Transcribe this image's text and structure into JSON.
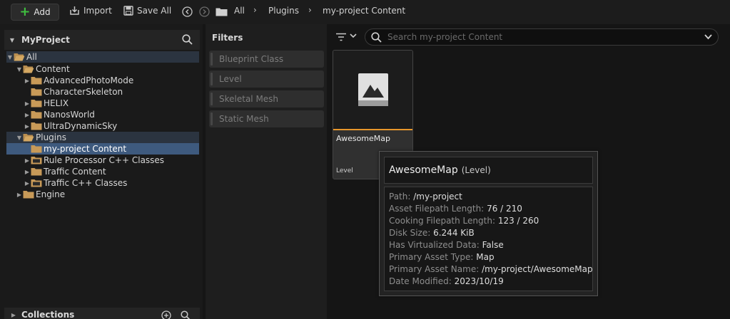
{
  "toolbar": {
    "add_label": "Add",
    "import_label": "Import",
    "save_all_label": "Save All"
  },
  "breadcrumb": [
    "All",
    "Plugins",
    "my-project Content"
  ],
  "sources": {
    "title": "MyProject",
    "tree": {
      "all": "All",
      "content": "Content",
      "advanced_photo_mode": "AdvancedPhotoMode",
      "character_skeleton": "CharacterSkeleton",
      "helix": "HELIX",
      "nanos_world": "NanosWorld",
      "ultra_dynamic_sky": "UltraDynamicSky",
      "plugins": "Plugins",
      "my_project_content": "my-project Content",
      "rule_processor": "Rule Processor C++ Classes",
      "traffic_content": "Traffic Content",
      "traffic_cpp": "Traffic C++ Classes",
      "engine": "Engine"
    },
    "collections_label": "Collections"
  },
  "filters": {
    "title": "Filters",
    "items": [
      "Blueprint Class",
      "Level",
      "Skeletal Mesh",
      "Static Mesh"
    ]
  },
  "search": {
    "placeholder": "Search my-project Content"
  },
  "asset": {
    "name": "AwesomeMap",
    "type": "Level"
  },
  "tooltip": {
    "name": "AwesomeMap",
    "type": "(Level)",
    "rows": [
      {
        "key": "Path:",
        "value": "/my-project"
      },
      {
        "key": "Asset Filepath Length:",
        "value": "76 / 210"
      },
      {
        "key": "Cooking Filepath Length:",
        "value": "123 / 260"
      },
      {
        "key": "Disk Size:",
        "value": "6.244 KiB"
      },
      {
        "key": "Has Virtualized Data:",
        "value": "False"
      },
      {
        "key": "Primary Asset Type:",
        "value": "Map"
      },
      {
        "key": "Primary Asset Name:",
        "value": "/my-project/AwesomeMap"
      },
      {
        "key": "Date Modified:",
        "value": "2023/10/19"
      }
    ]
  },
  "colors": {
    "accent_orange": "#e8972b",
    "selection_blue": "#3e5a7e",
    "add_green": "#3fbf3f",
    "folder_tan": "#c89a58"
  }
}
